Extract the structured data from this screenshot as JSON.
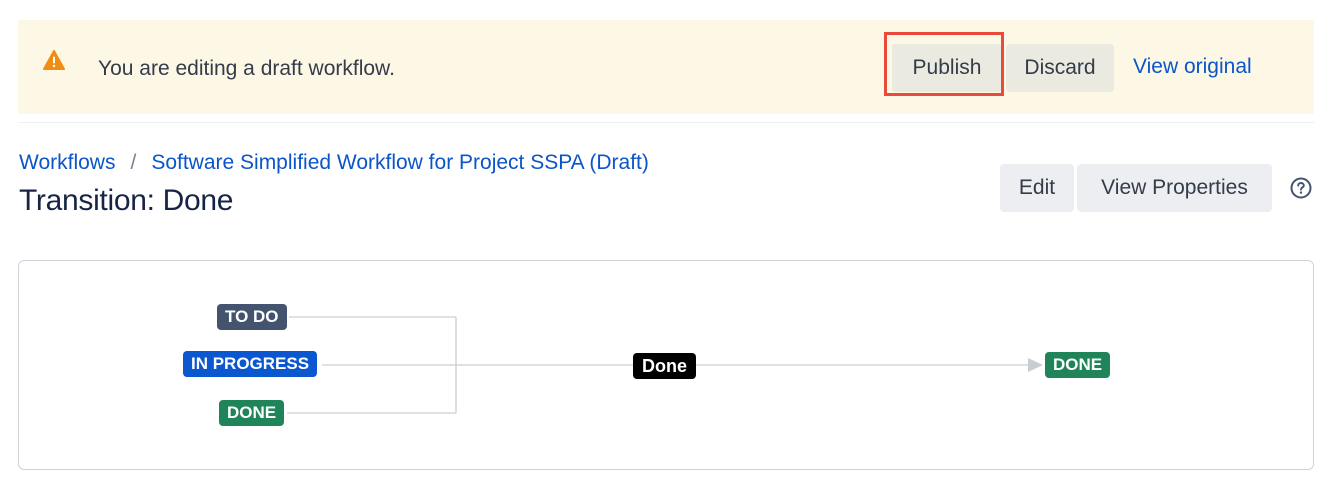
{
  "banner": {
    "message": "You are editing a draft workflow.",
    "publish_label": "Publish",
    "discard_label": "Discard",
    "view_original_label": "View original",
    "icon": "warning-icon",
    "icon_color": "#f18d13"
  },
  "breadcrumb": {
    "items": [
      "Workflows",
      "Software Simplified Workflow for Project SSPA (Draft)"
    ],
    "separator": "/"
  },
  "page": {
    "title": "Transition: Done"
  },
  "actions": {
    "edit_label": "Edit",
    "view_properties_label": "View Properties",
    "help_icon": "help-icon"
  },
  "diagram": {
    "sources": [
      {
        "label": "TO DO",
        "color": "#44546f"
      },
      {
        "label": "IN PROGRESS",
        "color": "#0b57d0"
      },
      {
        "label": "DONE",
        "color": "#1f845a"
      }
    ],
    "transition": {
      "label": "Done",
      "color": "#000000"
    },
    "target": {
      "label": "DONE",
      "color": "#1f845a"
    }
  },
  "colors": {
    "link": "#0a55c9",
    "banner_bg": "#fdf7e6",
    "highlight": "#ea4a3c"
  }
}
